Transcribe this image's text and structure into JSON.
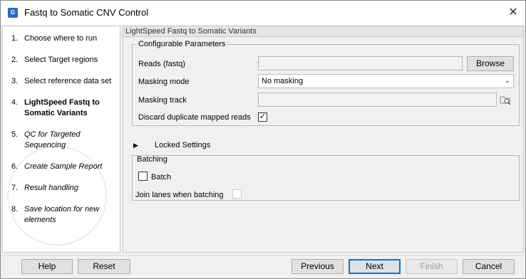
{
  "window": {
    "title": "Fastq to Somatic CNV Control",
    "app_icon": "clc-app-icon",
    "app_icon_text": "G"
  },
  "sidebar": {
    "steps": [
      {
        "num": "1.",
        "label": "Choose where to run",
        "style": "normal"
      },
      {
        "num": "2.",
        "label": "Select Target regions",
        "style": "normal"
      },
      {
        "num": "3.",
        "label": "Select reference data set",
        "style": "normal"
      },
      {
        "num": "4.",
        "label": "LightSpeed Fastq to Somatic Variants",
        "style": "current"
      },
      {
        "num": "5.",
        "label": "QC for Targeted Sequencing",
        "style": "italic"
      },
      {
        "num": "6.",
        "label": "Create Sample Report",
        "style": "italic"
      },
      {
        "num": "7.",
        "label": "Result handling",
        "style": "italic"
      },
      {
        "num": "8.",
        "label": "Save location for new elements",
        "style": "italic"
      }
    ]
  },
  "content": {
    "header": "LightSpeed Fastq to Somatic Variants",
    "configurable": {
      "title": "Configurable Parameters",
      "reads_label": "Reads (fastq)",
      "reads_value": "",
      "browse_label": "Browse",
      "masking_mode_label": "Masking mode",
      "masking_mode_value": "No masking",
      "masking_track_label": "Masking track",
      "masking_track_value": "",
      "discard_label": "Discard duplicate mapped reads",
      "discard_checked": true
    },
    "locked_label": "Locked Settings",
    "batching": {
      "title": "Batching",
      "batch_label": "Batch",
      "batch_checked": false,
      "join_label": "Join lanes when batching",
      "join_checked": false
    }
  },
  "footer": {
    "help": "Help",
    "reset": "Reset",
    "previous": "Previous",
    "next": "Next",
    "finish": "Finish",
    "cancel": "Cancel"
  },
  "colors": {
    "accent": "#0078d7",
    "app_icon_bg": "#1f6fc6"
  }
}
